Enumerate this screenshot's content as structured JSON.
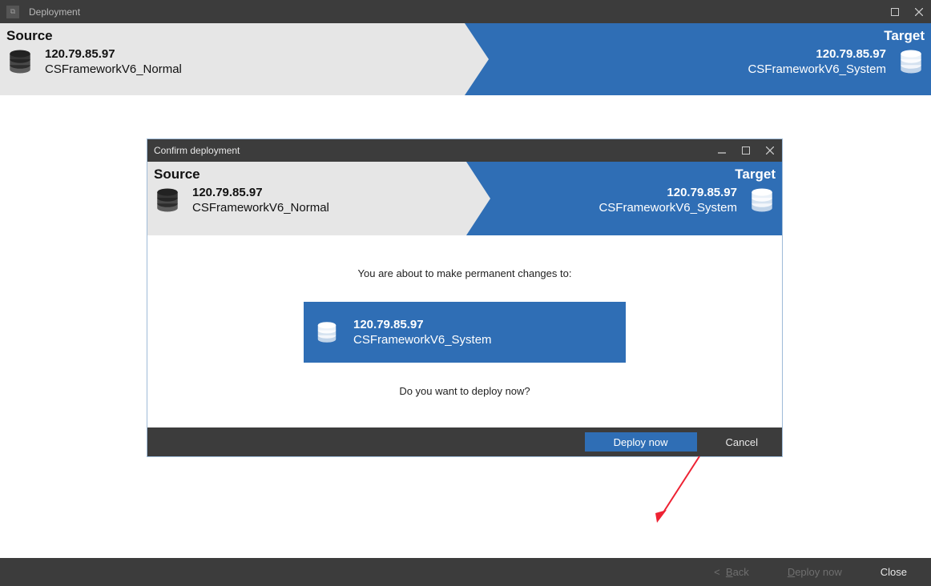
{
  "window": {
    "title": "Deployment"
  },
  "banner": {
    "source": {
      "label": "Source",
      "ip": "120.79.85.97",
      "db": "CSFrameworkV6_Normal"
    },
    "target": {
      "label": "Target",
      "ip": "120.79.85.97",
      "db": "CSFrameworkV6_System"
    }
  },
  "dialog": {
    "title": "Confirm deployment",
    "source": {
      "label": "Source",
      "ip": "120.79.85.97",
      "db": "CSFrameworkV6_Normal"
    },
    "target": {
      "label": "Target",
      "ip": "120.79.85.97",
      "db": "CSFrameworkV6_System"
    },
    "about_line": "You are about to make permanent changes to:",
    "confirm_card": {
      "ip": "120.79.85.97",
      "db": "CSFrameworkV6_System"
    },
    "question_line": "Do you want to deploy now?",
    "buttons": {
      "deploy": "Deploy now",
      "cancel": "Cancel"
    }
  },
  "footer": {
    "back": "<  Back",
    "deploy": "Deploy now",
    "close": "Close"
  },
  "colors": {
    "accent": "#2f6eb5",
    "titlebar": "#3c3c3c",
    "banner_light": "#e6e6e6"
  }
}
